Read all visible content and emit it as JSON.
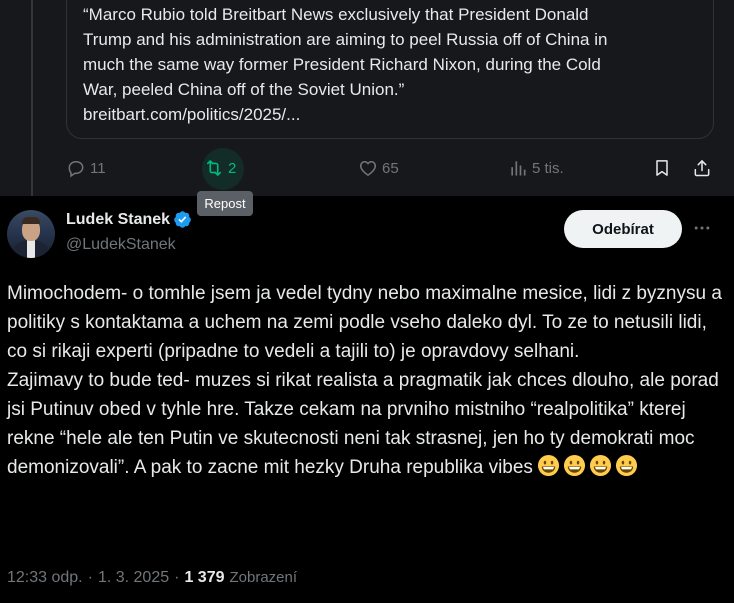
{
  "quoted_tweet": {
    "text": "“Marco Rubio told Breitbart News exclusively that President Donald\nTrump and his administration are aiming to peel Russia off of China in\nmuch the same way former President Richard Nixon, during the Cold\nWar, peeled China off of the Soviet Union.”",
    "link": "breitbart.com/politics/2025/..."
  },
  "actions": {
    "replies": "11",
    "reposts": "2",
    "likes": "65",
    "views": "5 tis."
  },
  "tooltip": "Repost",
  "author": {
    "name": "Ludek Stanek",
    "handle": "@LudekStanek",
    "follow_label": "Odebírat"
  },
  "tweet": {
    "paragraph1": "Mimochodem- o tomhle jsem ja vedel tydny nebo maximalne mesice, lidi z byznysu a politiky s kontaktama a uchem na zemi podle vseho daleko dyl. To ze to netusili lidi, co si rikaji experti (pripadne to vedeli a tajili to) je opravdovy selhani.",
    "paragraph2": "Zajimavy to bude ted- muzes si rikat realista a pragmatik jak chces dlouho, ale porad jsi Putinuv obed v tyhle hre. Takze cekam na prvniho mistniho “realpolitika” kterej rekne “hele ale ten Putin ve skutecnosti neni tak strasnej, jen ho ty demokrati moc demonizovali”. A pak to zacne mit hezky Druha republika vibes",
    "emoji_icon": "grinning-face-emoji"
  },
  "meta": {
    "time": "12:33 odp.",
    "sep1": "·",
    "date": "1. 3. 2025",
    "sep2": "·",
    "views_count": "1 379",
    "views_label": "Zobrazení"
  },
  "colors": {
    "background": "#000000",
    "upper_background": "#16181c",
    "text": "#e7e9ea",
    "muted": "#71767b",
    "repost_green": "#00ba7c",
    "verified_blue": "#1d9bf0",
    "follow_bg": "#eff3f4"
  }
}
